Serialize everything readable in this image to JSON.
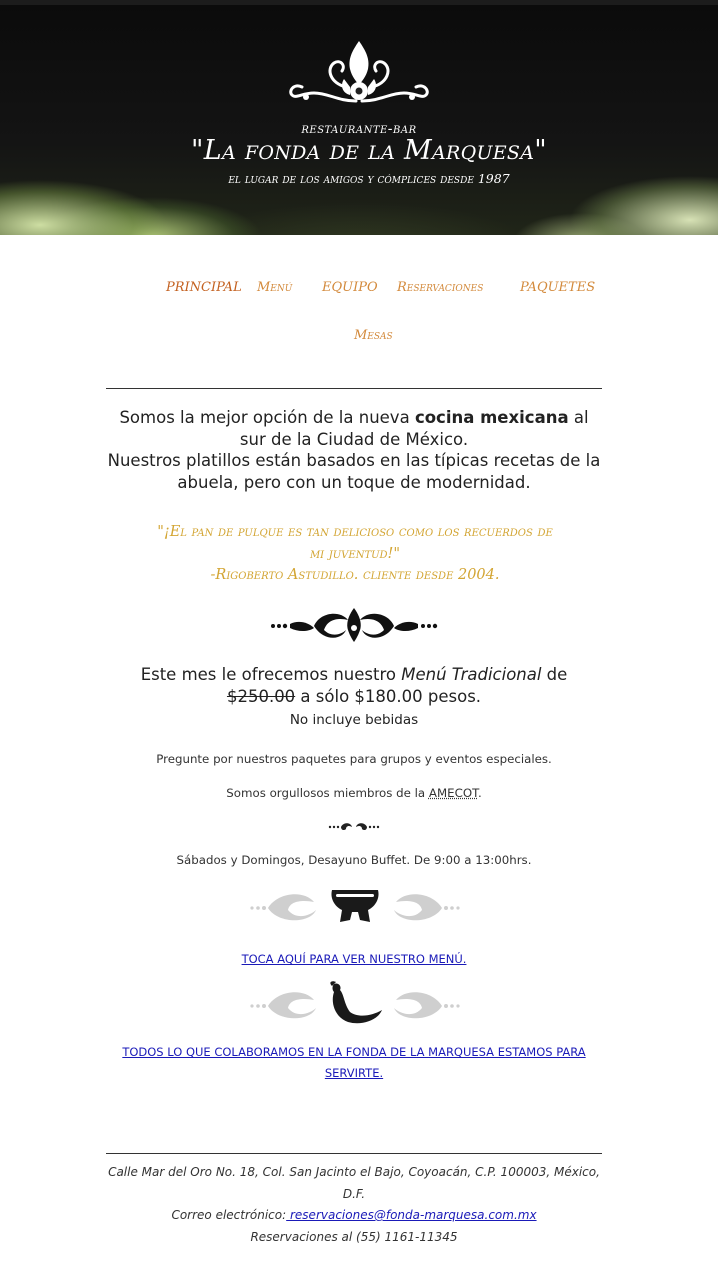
{
  "header": {
    "logo_icon": "fleur-de-lis-crest-icon",
    "subtitle": "restaurante-bar",
    "title": "\"La fonda de la Marquesa\"",
    "tagline": "el lugar de los amigos y cómplices desde 1987"
  },
  "nav": {
    "items": [
      {
        "label": "PRINCIPAL",
        "active": true
      },
      {
        "label": "Menú"
      },
      {
        "label": "EQUIPO"
      },
      {
        "label": "Reservaciones"
      },
      {
        "label": "PAQUETES"
      },
      {
        "label": "Mesas"
      }
    ],
    "colors": {
      "link": "#d38a3c",
      "active": "#c3601f"
    }
  },
  "intro": {
    "line1_a": "Somos la mejor opción de la nueva ",
    "line1_bold": "cocina mexicana",
    "line1_b": " al sur de la Ciudad de México.",
    "line2": "Nuestros platillos están basados en las típicas recetas de la abuela, pero con un toque de modernidad."
  },
  "quote": {
    "text": "\"¡El pan de pulque es tan delicioso como los recuerdos de mi juventud!\"",
    "author": "-Rigoberto Astudillo. cliente desde 2004.",
    "color": "#d3a533"
  },
  "offer": {
    "prefix": "Este mes le ofrecemos nuestro ",
    "menu_name": "Menú Tradicional",
    "mid": " de ",
    "old_price": "$250.00",
    "suffix": " a sólo $180.00 pesos.",
    "note": "No incluye bebidas"
  },
  "info": {
    "groups": "Pregunte por nuestros paquetes para grupos y eventos especiales.",
    "amecot_prefix": "Somos orgullosos miembros de la ",
    "amecot": "AMECOT",
    "amecot_suffix": ".",
    "buffet": "Sábados y Domingos, Desayuno Buffet. De 9:00 a 13:00hrs."
  },
  "icons": {
    "ornament_1": "black-scroll-ornament-icon",
    "ornament_2": "small-scroll-ornament-icon",
    "ornament_3": "molcajete-icon",
    "ornament_4": "chili-pepper-icon"
  },
  "links": {
    "menu": "TOCA AQUÍ PARA VER NUESTRO MENÚ.",
    "team": "TODOS LO QUE COLABORAMOS EN LA FONDA DE LA MARQUESA ESTAMOS PARA SERVIRTE."
  },
  "footer": {
    "address": "Calle Mar del Oro No. 18, Col. San Jacinto el Bajo, Coyoacán, C.P. 100003, México, D.F.",
    "email_label": "Correo electrónico:",
    "email": " reservaciones@fonda-marquesa.com.mx",
    "phone": "Reservaciones al (55) 1161-11345"
  }
}
